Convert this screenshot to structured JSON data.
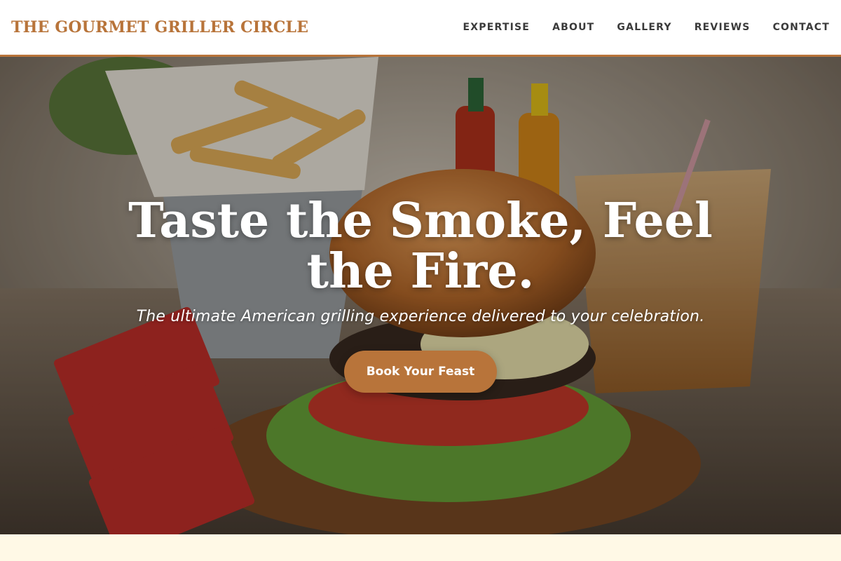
{
  "header": {
    "brand": "THE GOURMET GRILLER CIRCLE",
    "nav": [
      {
        "label": "EXPERTISE"
      },
      {
        "label": "ABOUT"
      },
      {
        "label": "GALLERY"
      },
      {
        "label": "REVIEWS"
      },
      {
        "label": "CONTACT"
      }
    ]
  },
  "hero": {
    "title": "Taste the Smoke, Feel the Fire.",
    "subtitle": "The ultimate American grilling experience delivered to your celebration.",
    "cta_label": "Book Your Feast",
    "image_subject": "burger-fries-drink-photo"
  },
  "colors": {
    "accent": "#b8743a",
    "nav_text": "#3a3a3a",
    "hero_text": "#ffffff",
    "section_bg": "#fff9e6"
  }
}
